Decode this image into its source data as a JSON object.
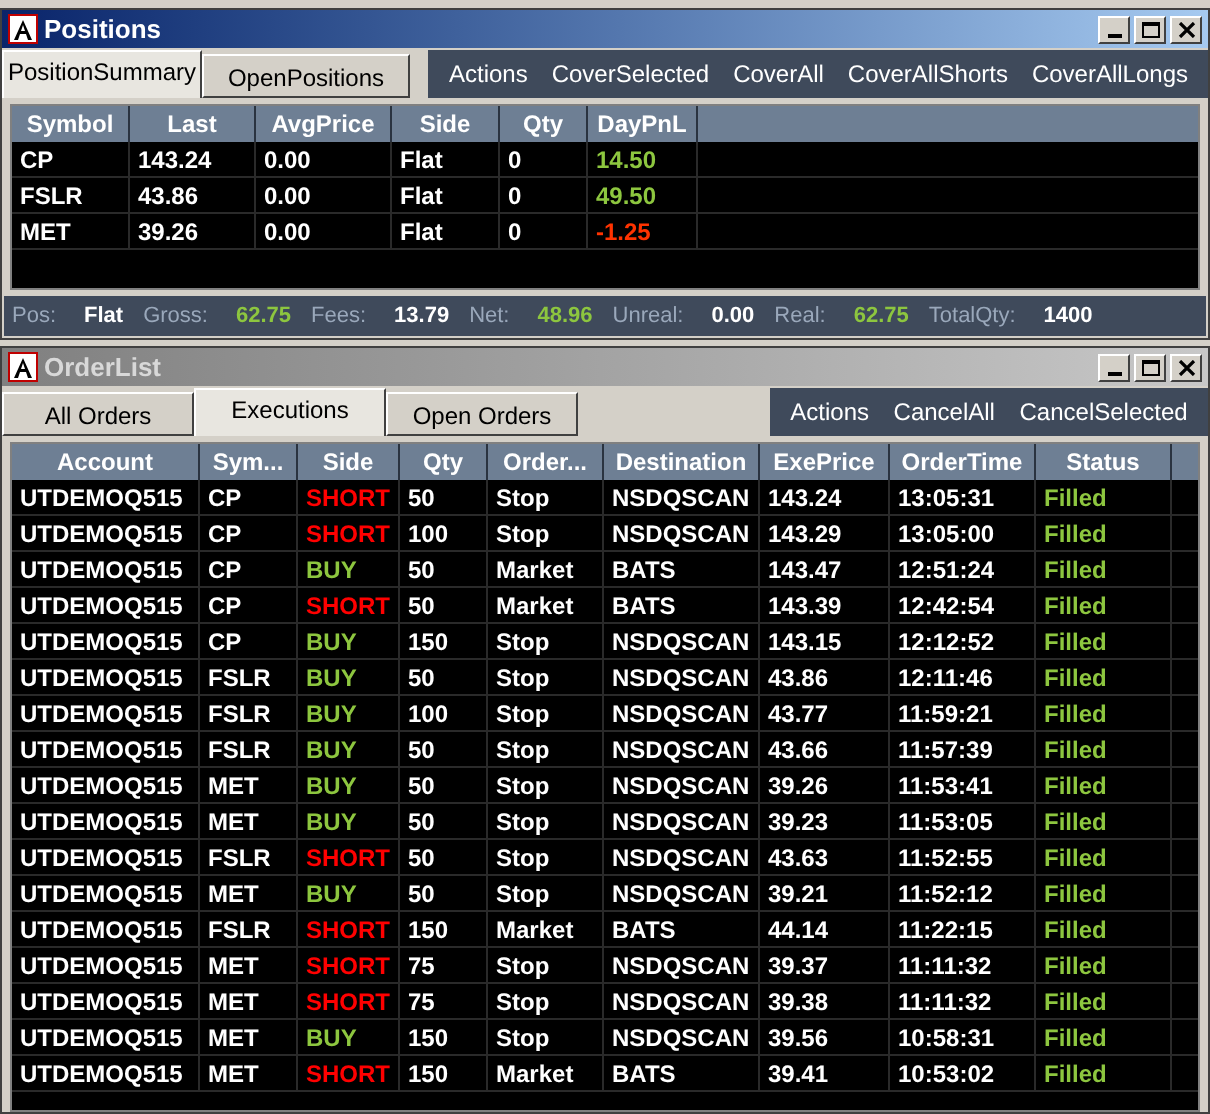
{
  "positions_window": {
    "title": "Positions",
    "tabs": [
      {
        "label": "PositionSummary",
        "selected": true
      },
      {
        "label": "OpenPositions",
        "selected": false
      }
    ],
    "actions": [
      "Actions",
      "CoverSelected",
      "CoverAll",
      "CoverAllShorts",
      "CoverAllLongs"
    ],
    "table": {
      "columns": [
        "Symbol",
        "Last",
        "AvgPrice",
        "Side",
        "Qty",
        "DayPnL"
      ],
      "rows": [
        {
          "cells": [
            "CP",
            "143.24",
            "0.00",
            "Flat",
            "0",
            "14.50"
          ],
          "color": "#8dc63f"
        },
        {
          "cells": [
            "FSLR",
            "43.86",
            "0.00",
            "Flat",
            "0",
            "49.50"
          ],
          "color": "#8dc63f"
        },
        {
          "cells": [
            "MET",
            "39.26",
            "0.00",
            "Flat",
            "0",
            "-1.25"
          ],
          "color": "#ff3300"
        }
      ]
    },
    "summary": [
      {
        "label": "Pos:",
        "value": "Flat",
        "kind": "plain"
      },
      {
        "label": "Gross:",
        "value": "62.75",
        "kind": "positive"
      },
      {
        "label": "Fees:",
        "value": "13.79",
        "kind": "plain"
      },
      {
        "label": "Net:",
        "value": "48.96",
        "kind": "positive"
      },
      {
        "label": "Unreal:",
        "value": "0.00",
        "kind": "plain"
      },
      {
        "label": "Real:",
        "value": "62.75",
        "kind": "positive"
      },
      {
        "label": "TotalQty:",
        "value": "1400",
        "kind": "plain"
      }
    ]
  },
  "orderlist_window": {
    "title": "OrderList",
    "tabs": [
      {
        "label": "All Orders",
        "selected": false
      },
      {
        "label": "Executions",
        "selected": true
      },
      {
        "label": "Open Orders",
        "selected": false
      }
    ],
    "actions": [
      "Actions",
      "CancelAll",
      "CancelSelected"
    ],
    "table": {
      "columns": [
        "Account",
        "Sym...",
        "Side",
        "Qty",
        "Order...",
        "Destination",
        "ExePrice",
        "OrderTime",
        "Status"
      ],
      "rows": [
        {
          "cells": [
            "UTDEMOQ515",
            "CP",
            "SHORT",
            "50",
            "Stop",
            "NSDQSCAN",
            "143.24",
            "13:05:31",
            "Filled"
          ],
          "color": "#ff0000"
        },
        {
          "cells": [
            "UTDEMOQ515",
            "CP",
            "SHORT",
            "100",
            "Stop",
            "NSDQSCAN",
            "143.29",
            "13:05:00",
            "Filled"
          ],
          "color": "#ff0000"
        },
        {
          "cells": [
            "UTDEMOQ515",
            "CP",
            "BUY",
            "50",
            "Market",
            "BATS",
            "143.47",
            "12:51:24",
            "Filled"
          ],
          "color": "#8dc63f"
        },
        {
          "cells": [
            "UTDEMOQ515",
            "CP",
            "SHORT",
            "50",
            "Market",
            "BATS",
            "143.39",
            "12:42:54",
            "Filled"
          ],
          "color": "#ff0000"
        },
        {
          "cells": [
            "UTDEMOQ515",
            "CP",
            "BUY",
            "150",
            "Stop",
            "NSDQSCAN",
            "143.15",
            "12:12:52",
            "Filled"
          ],
          "color": "#8dc63f"
        },
        {
          "cells": [
            "UTDEMOQ515",
            "FSLR",
            "BUY",
            "50",
            "Stop",
            "NSDQSCAN",
            "43.86",
            "12:11:46",
            "Filled"
          ],
          "color": "#8dc63f"
        },
        {
          "cells": [
            "UTDEMOQ515",
            "FSLR",
            "BUY",
            "100",
            "Stop",
            "NSDQSCAN",
            "43.77",
            "11:59:21",
            "Filled"
          ],
          "color": "#8dc63f"
        },
        {
          "cells": [
            "UTDEMOQ515",
            "FSLR",
            "BUY",
            "50",
            "Stop",
            "NSDQSCAN",
            "43.66",
            "11:57:39",
            "Filled"
          ],
          "color": "#8dc63f"
        },
        {
          "cells": [
            "UTDEMOQ515",
            "MET",
            "BUY",
            "50",
            "Stop",
            "NSDQSCAN",
            "39.26",
            "11:53:41",
            "Filled"
          ],
          "color": "#8dc63f"
        },
        {
          "cells": [
            "UTDEMOQ515",
            "MET",
            "BUY",
            "50",
            "Stop",
            "NSDQSCAN",
            "39.23",
            "11:53:05",
            "Filled"
          ],
          "color": "#8dc63f"
        },
        {
          "cells": [
            "UTDEMOQ515",
            "FSLR",
            "SHORT",
            "50",
            "Stop",
            "NSDQSCAN",
            "43.63",
            "11:52:55",
            "Filled"
          ],
          "color": "#ff0000"
        },
        {
          "cells": [
            "UTDEMOQ515",
            "MET",
            "BUY",
            "50",
            "Stop",
            "NSDQSCAN",
            "39.21",
            "11:52:12",
            "Filled"
          ],
          "color": "#8dc63f"
        },
        {
          "cells": [
            "UTDEMOQ515",
            "FSLR",
            "SHORT",
            "150",
            "Market",
            "BATS",
            "44.14",
            "11:22:15",
            "Filled"
          ],
          "color": "#ff0000"
        },
        {
          "cells": [
            "UTDEMOQ515",
            "MET",
            "SHORT",
            "75",
            "Stop",
            "NSDQSCAN",
            "39.37",
            "11:11:32",
            "Filled"
          ],
          "color": "#ff0000"
        },
        {
          "cells": [
            "UTDEMOQ515",
            "MET",
            "SHORT",
            "75",
            "Stop",
            "NSDQSCAN",
            "39.38",
            "11:11:32",
            "Filled"
          ],
          "color": "#ff0000"
        },
        {
          "cells": [
            "UTDEMOQ515",
            "MET",
            "BUY",
            "150",
            "Stop",
            "NSDQSCAN",
            "39.56",
            "10:58:31",
            "Filled"
          ],
          "color": "#8dc63f"
        },
        {
          "cells": [
            "UTDEMOQ515",
            "MET",
            "SHORT",
            "150",
            "Market",
            "BATS",
            "39.41",
            "10:53:02",
            "Filled"
          ],
          "color": "#ff0000"
        }
      ]
    }
  }
}
